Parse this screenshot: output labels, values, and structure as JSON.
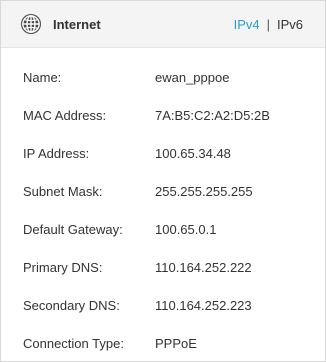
{
  "header": {
    "title": "Internet",
    "icon": "globe-icon",
    "tabs": [
      {
        "label": "IPv4",
        "active": true
      },
      {
        "label": "IPv6",
        "active": false
      }
    ],
    "separator": "|",
    "accent_color": "#2b9bd3"
  },
  "info": {
    "name": {
      "label": "Name:",
      "value": "ewan_pppoe"
    },
    "mac": {
      "label": "MAC Address:",
      "value": "7A:B5:C2:A2:D5:2B"
    },
    "ip": {
      "label": "IP Address:",
      "value": "100.65.34.48"
    },
    "subnet": {
      "label": "Subnet Mask:",
      "value": "255.255.255.255"
    },
    "gateway": {
      "label": "Default Gateway:",
      "value": "100.65.0.1"
    },
    "dns1": {
      "label": "Primary DNS:",
      "value": "110.164.252.222"
    },
    "dns2": {
      "label": "Secondary DNS:",
      "value": "110.164.252.223"
    },
    "conn_type": {
      "label": "Connection Type:",
      "value": "PPPoE"
    }
  }
}
